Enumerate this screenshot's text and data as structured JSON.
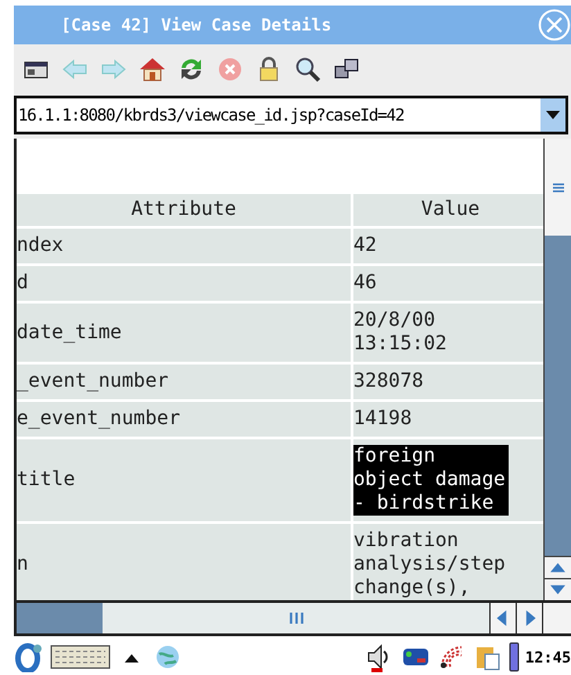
{
  "window": {
    "title": "[Case 42] View Case Details"
  },
  "address_bar": {
    "value": "16.1.1:8080/kbrds3/viewcase_id.jsp?caseId=42"
  },
  "table": {
    "columns": [
      "Attribute",
      "Value"
    ],
    "rows": [
      {
        "attribute": "ndex",
        "value": [
          "42"
        ],
        "highlighted": false
      },
      {
        "attribute": "d",
        "value": [
          "46"
        ],
        "highlighted": false
      },
      {
        "attribute": "date_time",
        "value": [
          "20/8/00",
          "13:15:02"
        ],
        "highlighted": false
      },
      {
        "attribute": "_event_number",
        "value": [
          "328078"
        ],
        "highlighted": false
      },
      {
        "attribute": "e_event_number",
        "value": [
          "14198"
        ],
        "highlighted": false
      },
      {
        "attribute": "title",
        "value": [
          "foreign",
          "object damage",
          "- birdstrike"
        ],
        "highlighted": true
      },
      {
        "attribute": "n",
        "value": [
          "vibration",
          "analysis/step",
          "change(s),"
        ],
        "highlighted": false
      }
    ]
  },
  "taskbar": {
    "clock": "12:45"
  }
}
